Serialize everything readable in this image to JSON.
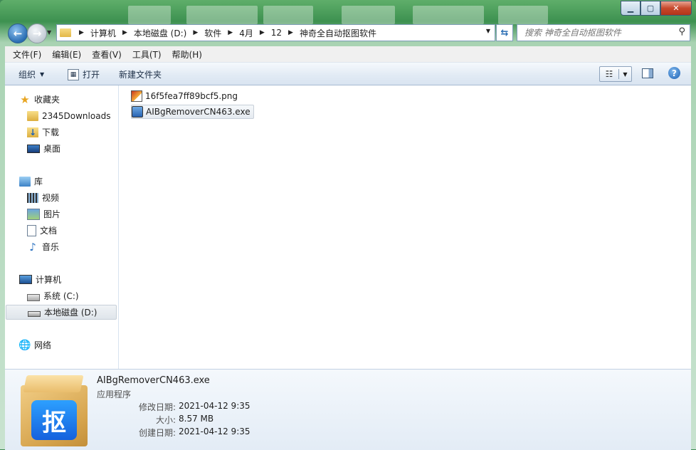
{
  "address": {
    "crumbs": [
      "计算机",
      "本地磁盘 (D:)",
      "软件",
      "4月",
      "12",
      "神奇全自动抠图软件"
    ]
  },
  "search": {
    "placeholder": "搜索 神奇全自动抠图软件"
  },
  "menu": [
    "文件(F)",
    "编辑(E)",
    "查看(V)",
    "工具(T)",
    "帮助(H)"
  ],
  "toolbar": {
    "organize": "组织",
    "open": "打开",
    "new_folder": "新建文件夹"
  },
  "nav": {
    "favorites": "收藏夹",
    "fav_items": [
      "2345Downloads",
      "下载",
      "桌面"
    ],
    "libraries": "库",
    "lib_items": [
      "视频",
      "图片",
      "文档",
      "音乐"
    ],
    "computer": "计算机",
    "drives": [
      "系统 (C:)",
      "本地磁盘 (D:)"
    ],
    "network": "网络"
  },
  "files": [
    {
      "name": "16f5fea7ff89bcf5.png",
      "selected": false
    },
    {
      "name": "AIBgRemoverCN463.exe",
      "selected": true
    }
  ],
  "details": {
    "name": "AIBgRemoverCN463.exe",
    "type": "应用程序",
    "icon_glyph": "抠",
    "modified_label": "修改日期:",
    "modified": "2021-04-12 9:35",
    "size_label": "大小:",
    "size": "8.57 MB",
    "created_label": "创建日期:",
    "created": "2021-04-12 9:35"
  }
}
